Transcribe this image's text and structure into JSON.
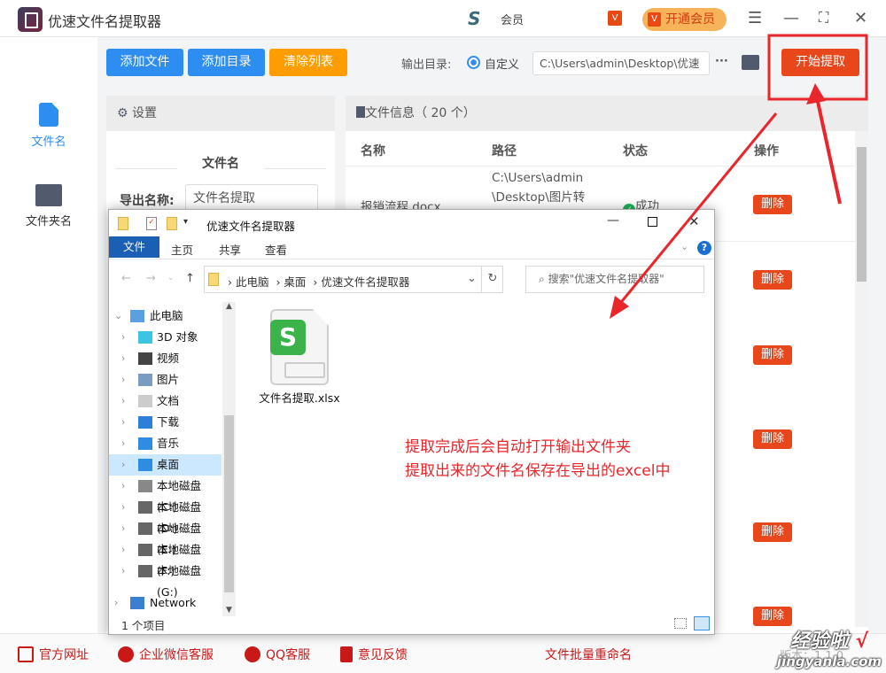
{
  "app": {
    "title": "优速文件名提取器",
    "member_text": "会员",
    "vip_label": "开通会员",
    "vip_badge": "V"
  },
  "toolbar": {
    "add_file": "添加文件",
    "add_dir": "添加目录",
    "clear_list": "清除列表",
    "output_label": "输出目录:",
    "radio_label": "自定义",
    "output_path": "C:\\Users\\admin\\Desktop\\优速",
    "more": "···",
    "start": "开始提取"
  },
  "sidebar": {
    "items": [
      {
        "label": "文件名",
        "active": true
      },
      {
        "label": "文件夹名",
        "active": false
      }
    ]
  },
  "settings": {
    "title": "设置",
    "section": "文件名",
    "export_label": "导出名称:",
    "export_value": "文件名提取"
  },
  "files": {
    "title": "文件信息（ 20 个）",
    "columns": [
      "名称",
      "路径",
      "状态",
      "操作"
    ],
    "rows": [
      {
        "name": "报销流程.docx",
        "path": "C:\\Users\\admin\\Desktop\\图片转换\\文件名提取器\\",
        "status": "成功",
        "action": "删除"
      },
      {
        "action": "删除"
      },
      {
        "action": "删除"
      },
      {
        "action": "删除"
      },
      {
        "action": "删除"
      },
      {
        "action": "删除"
      }
    ]
  },
  "footer": {
    "links": [
      "官方网址",
      "企业微信客服",
      "QQ客服",
      "意见反馈"
    ],
    "rename": "文件批量重命名",
    "version": "版本：1.1.0"
  },
  "explorer": {
    "title": "优速文件名提取器",
    "tabs": [
      "文件",
      "主页",
      "共享",
      "查看"
    ],
    "breadcrumb": [
      "此电脑",
      "桌面",
      "优速文件名提取器"
    ],
    "search_placeholder": "搜索\"优速文件名提取器\"",
    "nav": [
      "此电脑",
      "3D 对象",
      "视频",
      "图片",
      "文档",
      "下载",
      "音乐",
      "桌面",
      "本地磁盘 (C:)",
      "本地磁盘 (D:)",
      "本地磁盘 (E:)",
      "本地磁盘 (F:)",
      "本地磁盘 (G:)",
      "Network"
    ],
    "selected_nav": "桌面",
    "file": "文件名提取.xlsx",
    "status": "1 个项目"
  },
  "annotation": {
    "line1": "提取完成后会自动打开输出文件夹",
    "line2": "提取出来的文件名保存在导出的excel中"
  },
  "watermark": {
    "text": "经验啦",
    "url": "jingyanla.com"
  },
  "colors": {
    "blue": "#2e8df0",
    "orange": "#ff9900",
    "red": "#e8471b",
    "annotation": "#e8262b"
  }
}
